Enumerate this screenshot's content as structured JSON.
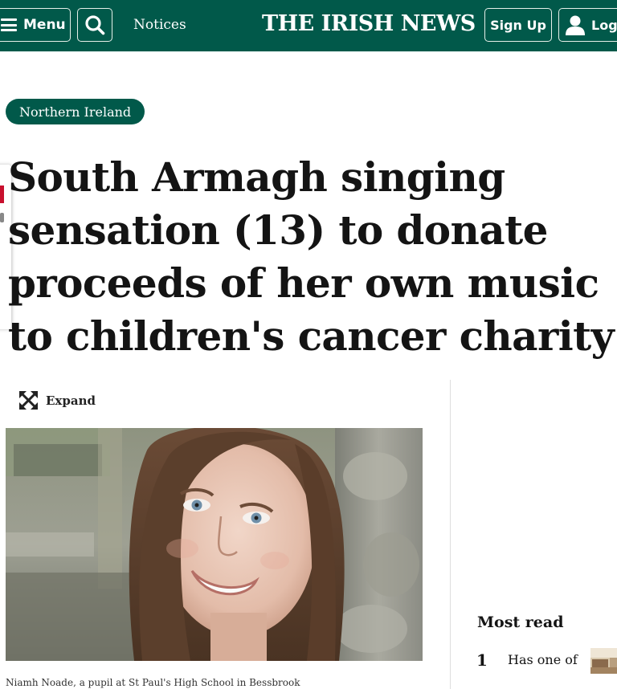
{
  "header": {
    "menu_label": "Menu",
    "notices_label": "Notices",
    "masthead": "THE IRISH NEWS",
    "signup_label": "Sign Up",
    "login_label": "Log"
  },
  "article": {
    "category": "Northern Ireland",
    "headline": "South Armagh singing sensation (13) to donate proceeds of her own music to children's cancer charity",
    "expand_label": "Expand",
    "image_caption": "Niamh Noade, a pupil at St Paul's High School in Bessbrook"
  },
  "sidebar": {
    "most_read_title": "Most read",
    "items": [
      {
        "number": "1",
        "text": "Has one of"
      }
    ]
  },
  "colors": {
    "brand_green": "#01594a",
    "text": "#141414"
  }
}
